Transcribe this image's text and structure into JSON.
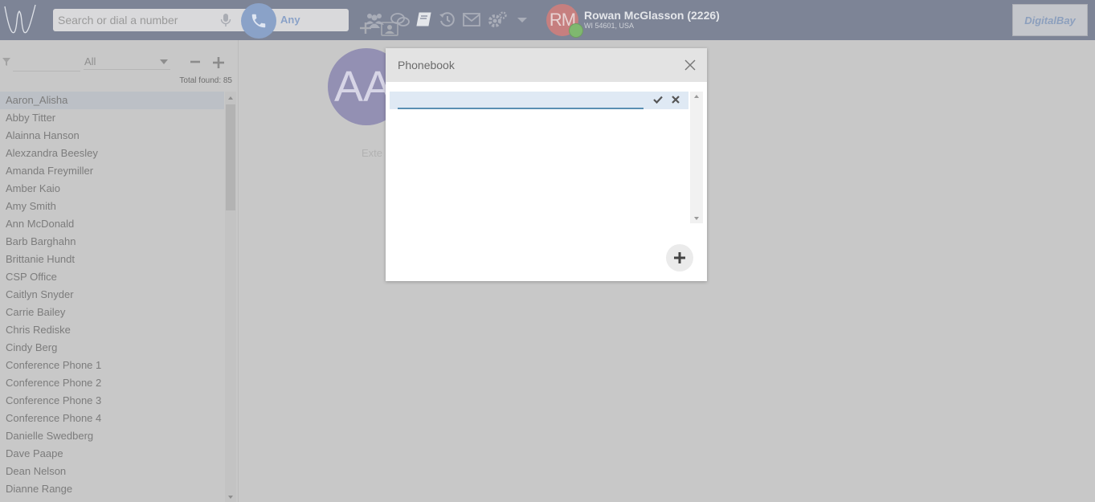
{
  "header": {
    "search": {
      "placeholder": "Search or dial a number",
      "value": ""
    },
    "line_selector": "Any",
    "user": {
      "initials": "RM",
      "name": "Rowan McGlasson (2226)",
      "location": "WI 54601, USA",
      "status_color": "#7fb86f"
    },
    "brand": "DigitalBay",
    "icons": [
      "logo-icon",
      "microphone-icon",
      "phone-icon",
      "plus-icon",
      "contact-card-icon",
      "users-icon",
      "chat-icon",
      "phonebook-icon",
      "history-icon",
      "mail-icon",
      "settings-icon",
      "chevron-down-icon"
    ]
  },
  "sidebar": {
    "group_filter": "All",
    "total_found": "Total found: 85",
    "contacts": [
      "Aaron_Alisha",
      "Abby Titter",
      "Alainna Hanson",
      "Alexzandra Beesley",
      "Amanda Freymiller",
      "Amber Kaio",
      "Amy Smith",
      "Ann McDonald",
      "Barb Barghahn",
      "Brittanie Hundt",
      "CSP Office",
      "Caitlyn Snyder",
      "Carrie Bailey",
      "Chris Rediske",
      "Cindy Berg",
      "Conference Phone 1",
      "Conference Phone 2",
      "Conference Phone 3",
      "Conference Phone 4",
      "Danielle Swedberg",
      "Dave Paape",
      "Dean Nelson",
      "Dianne Range"
    ],
    "selected_index": 0
  },
  "main": {
    "avatar_initials": "AA",
    "ext_label": "Exte"
  },
  "modal": {
    "title": "Phonebook",
    "new_entry_value": ""
  }
}
